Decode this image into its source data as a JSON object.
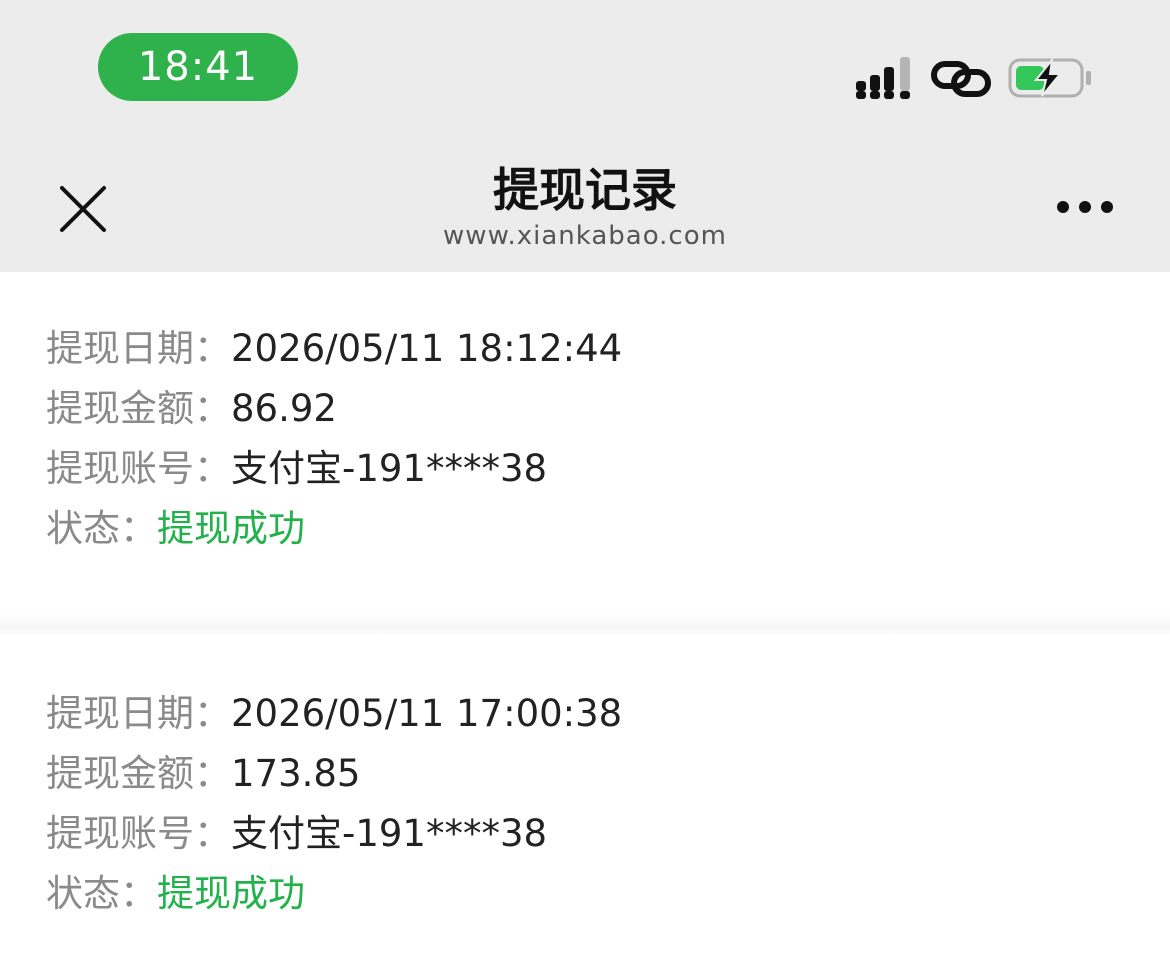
{
  "status_bar": {
    "time": "18:41",
    "icons": [
      "signal-icon",
      "link-icon",
      "battery-charging-icon"
    ],
    "time_pill_color": "#2fb24c",
    "battery_color": "#34c759"
  },
  "nav": {
    "title": "提现记录",
    "subtitle": "www.xiankabao.com",
    "close_icon": "close-icon",
    "more_icon": "more-icon"
  },
  "labels": {
    "date": "提现日期：",
    "amount": "提现金额：",
    "account": "提现账号：",
    "status": "状态："
  },
  "records": [
    {
      "date": "2026/05/11 18:12:44",
      "amount": "86.92",
      "account": "支付宝-191****38",
      "status": "提现成功"
    },
    {
      "date": "2026/05/11 17:00:38",
      "amount": "173.85",
      "account": "支付宝-191****38",
      "status": "提现成功"
    }
  ],
  "colors": {
    "accent_orange": "#f5a623",
    "success_green": "#21b24a"
  }
}
